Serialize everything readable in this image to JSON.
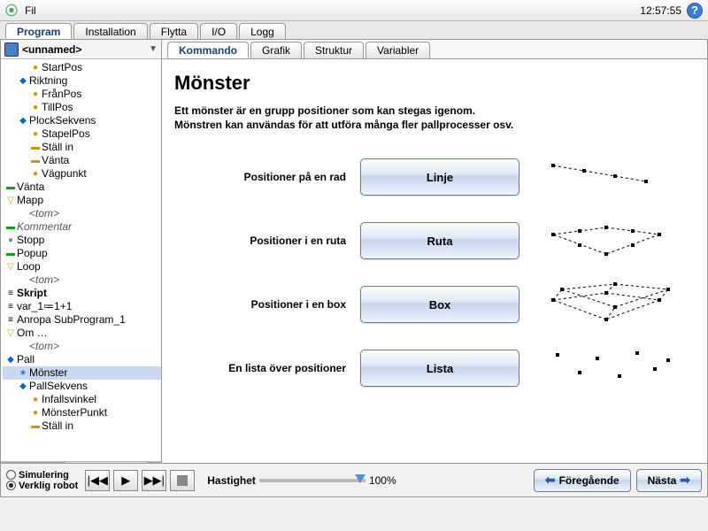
{
  "titlebar": {
    "menu_fil": "Fil",
    "clock": "12:57:55"
  },
  "main_tabs": [
    "Program",
    "Installation",
    "Flytta",
    "I/O",
    "Logg"
  ],
  "main_tab_active": 0,
  "program_name": "<unnamed>",
  "tree": [
    {
      "ind": 2,
      "icon": "●",
      "cls": "t-yellow",
      "text": "StartPos"
    },
    {
      "ind": 1,
      "icon": "◆",
      "cls": "t-blue",
      "text": "Riktning"
    },
    {
      "ind": 2,
      "icon": "●",
      "cls": "t-yellow",
      "text": "FrånPos"
    },
    {
      "ind": 2,
      "icon": "●",
      "cls": "t-yellow",
      "text": "TillPos"
    },
    {
      "ind": 1,
      "icon": "◆",
      "cls": "t-blue",
      "text": "PlockSekvens"
    },
    {
      "ind": 2,
      "icon": "●",
      "cls": "t-yellow",
      "text": "StapelPos"
    },
    {
      "ind": 2,
      "icon": "▬",
      "cls": "t-yellow",
      "text": "Ställ in"
    },
    {
      "ind": 2,
      "icon": "▬",
      "cls": "t-yellow",
      "text": "Vänta"
    },
    {
      "ind": 2,
      "icon": "●",
      "cls": "t-yellow",
      "text": "Vägpunkt"
    },
    {
      "ind": 0,
      "icon": "▬",
      "cls": "t-green",
      "text": "Vänta"
    },
    {
      "ind": 0,
      "icon": "▽",
      "cls": "t-yellow",
      "text": "Mapp"
    },
    {
      "ind": 1,
      "icon": "",
      "cls": "ital",
      "text": "<tom>"
    },
    {
      "ind": 0,
      "icon": "▬",
      "cls": "t-green",
      "text": "Kommentar",
      "extra": "ital"
    },
    {
      "ind": 0,
      "icon": "●",
      "cls": "t-grey",
      "text": "Stopp"
    },
    {
      "ind": 0,
      "icon": "▬",
      "cls": "t-green",
      "text": "Popup"
    },
    {
      "ind": 0,
      "icon": "▽",
      "cls": "t-yellow",
      "text": "Loop"
    },
    {
      "ind": 1,
      "icon": "",
      "cls": "ital",
      "text": "<tom>"
    },
    {
      "ind": 0,
      "icon": "≡",
      "cls": "",
      "text": "Skript",
      "extra": "bold"
    },
    {
      "ind": 0,
      "icon": "≡",
      "cls": "",
      "text": "var_1≔1+1"
    },
    {
      "ind": 0,
      "icon": "≡",
      "cls": "",
      "text": "Anropa SubProgram_1"
    },
    {
      "ind": 0,
      "icon": "▽",
      "cls": "t-yellow",
      "text": "Om …"
    },
    {
      "ind": 1,
      "icon": "",
      "cls": "ital",
      "text": "<tom>"
    },
    {
      "ind": 0,
      "icon": "◆",
      "cls": "t-blue",
      "text": "Pall"
    },
    {
      "ind": 1,
      "icon": "∗",
      "cls": "t-blue",
      "text": "Mönster",
      "selected": true
    },
    {
      "ind": 1,
      "icon": "◆",
      "cls": "t-blue",
      "text": "PallSekvens"
    },
    {
      "ind": 2,
      "icon": "●",
      "cls": "t-yellow",
      "text": "Infallsvinkel"
    },
    {
      "ind": 2,
      "icon": "●",
      "cls": "t-yellow",
      "text": "MönsterPunkt"
    },
    {
      "ind": 2,
      "icon": "▬",
      "cls": "t-yellow",
      "text": "Ställ in"
    }
  ],
  "sub_tabs": [
    "Kommando",
    "Grafik",
    "Struktur",
    "Variabler"
  ],
  "sub_tab_active": 0,
  "panel": {
    "title": "Mönster",
    "desc1": "Ett mönster är en grupp positioner som kan stegas igenom.",
    "desc2": "Mönstren kan användas för att utföra många fler pallprocesser osv.",
    "rows": [
      {
        "label": "Positioner på en rad",
        "button": "Linje",
        "diagram": "line"
      },
      {
        "label": "Positioner i en ruta",
        "button": "Ruta",
        "diagram": "square"
      },
      {
        "label": "Positioner i en box",
        "button": "Box",
        "diagram": "box"
      },
      {
        "label": "En lista över positioner",
        "button": "Lista",
        "diagram": "list"
      }
    ]
  },
  "footer": {
    "sim": "Simulering",
    "real": "Verklig robot",
    "speed_label": "Hastighet",
    "speed_value": "100%",
    "prev": "Föregående",
    "next": "Nästa"
  }
}
